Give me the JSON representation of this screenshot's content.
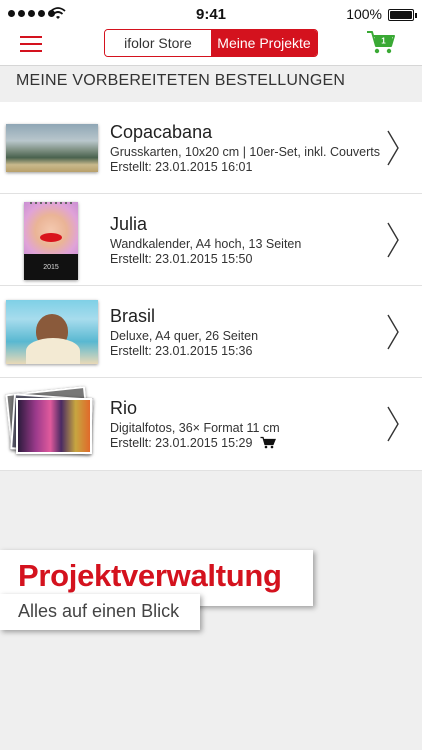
{
  "status_bar": {
    "time": "9:41",
    "battery": "100%",
    "signal_icon": "signal-dots-icon",
    "wifi_icon": "wifi-icon",
    "battery_icon": "battery-icon"
  },
  "nav": {
    "menu_icon": "hamburger-menu-icon",
    "tabs": [
      {
        "label": "ifolor Store",
        "active": false
      },
      {
        "label": "Meine Projekte",
        "active": true
      }
    ],
    "cart_count": "1",
    "cart_icon": "shopping-cart-icon"
  },
  "section": {
    "title": "MEINE VORBEREITETEN BESTELLUNGEN"
  },
  "projects": [
    {
      "title": "Copacabana",
      "description": "Grusskarten, 10x20 cm | 10er-Set, inkl. Couverts",
      "created": "Erstellt: 23.01.2015 16:01",
      "in_cart": false
    },
    {
      "title": "Julia",
      "description": "Wandkalender, A4 hoch, 13 Seiten",
      "created": "Erstellt: 23.01.2015 15:50",
      "thumb_text": "2015",
      "in_cart": false
    },
    {
      "title": "Brasil",
      "description": "Deluxe, A4 quer, 26 Seiten",
      "created": "Erstellt: 23.01.2015 15:36",
      "in_cart": false
    },
    {
      "title": "Rio",
      "description": "Digitalfotos, 36× Format 11 cm",
      "created": "Erstellt: 23.01.2015 15:29",
      "in_cart": true
    }
  ],
  "banner": {
    "headline": "Projektverwaltung",
    "subline": "Alles auf einen Blick"
  },
  "colors": {
    "accent": "#d4121e",
    "cart_green": "#3aa935"
  }
}
